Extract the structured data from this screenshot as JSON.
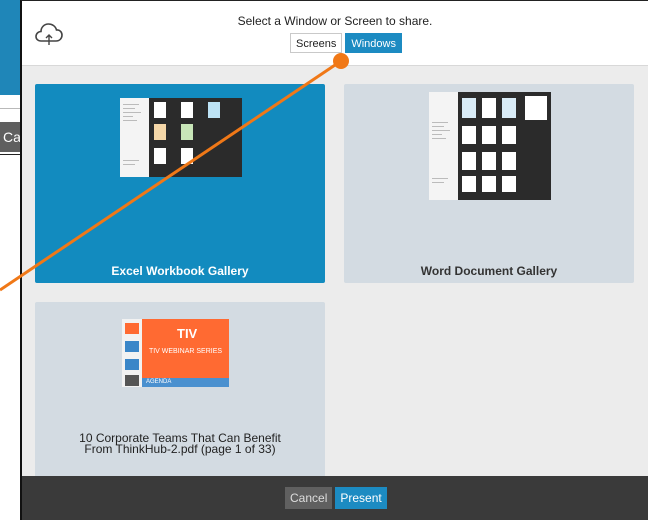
{
  "background": {
    "cancel_fragment": "Ca"
  },
  "header": {
    "prompt": "Select a Window or Screen to share.",
    "tabs": [
      {
        "label": "Screens",
        "active": false
      },
      {
        "label": "Windows",
        "active": true
      }
    ],
    "icon": "cloud-sync-icon"
  },
  "windows": [
    {
      "title": "Excel Workbook Gallery",
      "selected": true
    },
    {
      "title": "Word Document Gallery",
      "selected": false
    },
    {
      "title_line1": "10 Corporate Teams That Can Benefit",
      "title_line2": "From ThinkHub-2.pdf (page 1 of 33)",
      "selected": false
    }
  ],
  "pdf_thumbnail": {
    "logo": "TIV",
    "series": "TIV WEBINAR SERIES",
    "band": "AGENDA"
  },
  "footer": {
    "cancel_label": "Cancel",
    "present_label": "Present"
  },
  "colors": {
    "accent": "#1c8bc2",
    "selected_card": "#128bbf",
    "card": "#d3dbe2",
    "annotation": "#f07817"
  }
}
